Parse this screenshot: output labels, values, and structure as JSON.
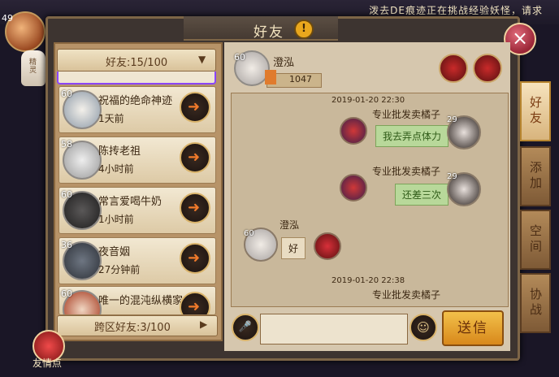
{
  "marquee": "泼去DE痕迹正在挑战经验妖怪，请求",
  "header": {
    "title": "好友",
    "warn": "!"
  },
  "close_icon": "×",
  "top_left": {
    "level": "49",
    "doll_label": "精灵"
  },
  "friend_list": {
    "dropdown_label": "好友:15/100",
    "dropdown_arrow": "▼",
    "items": [
      {
        "level": "60",
        "name": "祝福的绝命神迹",
        "time": "1天前"
      },
      {
        "level": "58",
        "name": "陈抟老祖",
        "time": "4小时前"
      },
      {
        "level": "60",
        "name": "常言爱喝牛奶",
        "time": "1小时前"
      },
      {
        "level": "36",
        "name": "夜音姻",
        "time": "27分钟前"
      },
      {
        "level": "60",
        "name": "唯一的混沌纵横家",
        "time": ""
      }
    ],
    "cross_label": "跨区好友:3/100",
    "cross_arrow": "▶"
  },
  "chat": {
    "user_level": "60",
    "user_name": "澄泓",
    "power": "1047",
    "messages": [
      {
        "timestamp": "2019-01-20 22:30",
        "sender": "专业批发卖橘子",
        "level": "29",
        "text": "我去弄点体力"
      },
      {
        "timestamp": "",
        "sender": "专业批发卖橘子",
        "level": "29",
        "text": "还差三次"
      },
      {
        "timestamp": "",
        "sender": "澄泓",
        "level": "60",
        "text": "好"
      },
      {
        "timestamp": "2019-01-20 22:38",
        "sender": "专业批发卖橘子",
        "level": "29",
        "text": ""
      }
    ]
  },
  "input_placeholder": "",
  "send_label": "送信",
  "side_tabs": [
    "好友",
    "添加",
    "空间",
    "协战"
  ],
  "friend_point_label": "友情点"
}
